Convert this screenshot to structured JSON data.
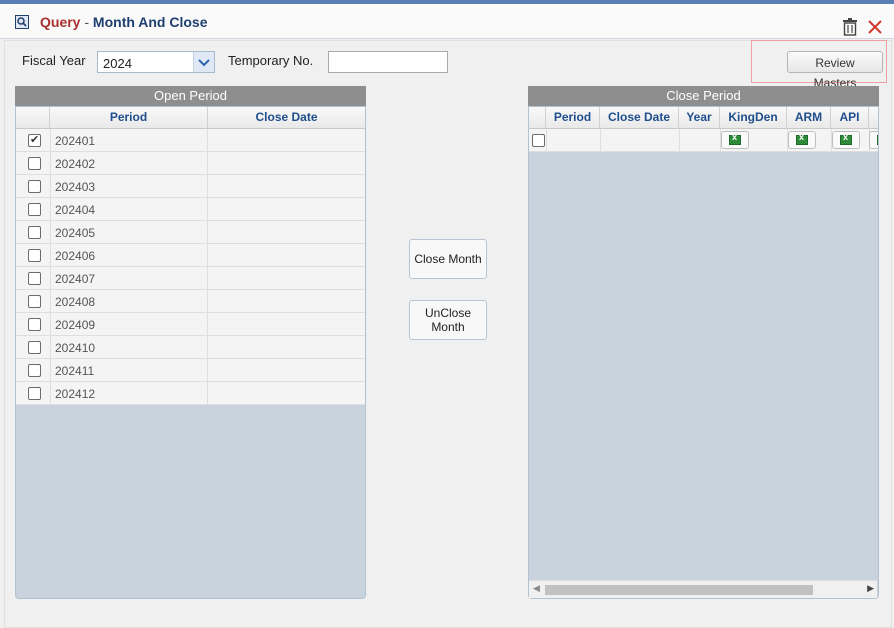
{
  "window": {
    "title_query": "Query",
    "title_sep": " - ",
    "title_rest": "Month And Close"
  },
  "filters": {
    "fiscal_year_label": "Fiscal Year",
    "fiscal_year_value": "2024",
    "temporary_no_label": "Temporary No.",
    "temporary_no_value": ""
  },
  "review_masters_label": "Review Masters",
  "open_period": {
    "title": "Open Period",
    "columns": [
      "Period",
      "Close Date"
    ],
    "rows": [
      {
        "period": "202401",
        "checked": true
      },
      {
        "period": "202402",
        "checked": false
      },
      {
        "period": "202403",
        "checked": false
      },
      {
        "period": "202404",
        "checked": false
      },
      {
        "period": "202405",
        "checked": false
      },
      {
        "period": "202406",
        "checked": false
      },
      {
        "period": "202407",
        "checked": false
      },
      {
        "period": "202408",
        "checked": false
      },
      {
        "period": "202409",
        "checked": false
      },
      {
        "period": "202410",
        "checked": false
      },
      {
        "period": "202411",
        "checked": false
      },
      {
        "period": "202412",
        "checked": false
      }
    ]
  },
  "actions": {
    "close_month": "Close Month",
    "unclose_month": "UnClose Month"
  },
  "close_period": {
    "title": "Close Period",
    "columns": [
      "Period",
      "Close Date",
      "Year",
      "KingDen",
      "ARM",
      "API"
    ]
  },
  "icons": {
    "title": "query-icon",
    "trash": "trash-icon",
    "close": "close-icon",
    "excel": "excel-icon"
  },
  "colors": {
    "title_query": "#a8312f",
    "title_rest": "#1f3f6e",
    "header_text": "#1f4e8c",
    "panel_bg": "#c8d3de",
    "accent_line": "#5a7fb5"
  }
}
